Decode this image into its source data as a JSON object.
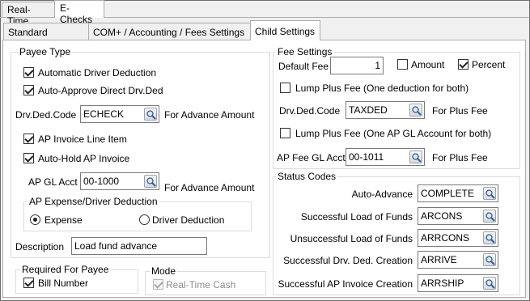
{
  "tabs_top": [
    "Real-Time",
    "E-Checks"
  ],
  "tabs_sub": [
    "Standard Settings",
    "COM+ / Accounting / Fees Settings",
    "Child Settings"
  ],
  "payee_type": {
    "legend": "Payee Type",
    "auto_driver_deduction": "Automatic Driver Deduction",
    "auto_approve": "Auto-Approve Direct Drv.Ded",
    "drv_ded_code_label": "Drv.Ded.Code",
    "drv_ded_code_value": "ECHECK",
    "for_advance_amount": "For Advance Amount",
    "ap_invoice_line_item": "AP Invoice Line Item",
    "auto_hold_ap_invoice": "Auto-Hold AP Invoice",
    "ap_gl_acct_label": "AP GL Acct",
    "ap_gl_acct_value": "00-1000",
    "for_advance_amount_2": "For Advance Amount",
    "ap_expense_legend": "AP Expense/Driver Deduction",
    "expense_label": "Expense",
    "driver_deduction_label": "Driver Deduction",
    "description_label": "Description",
    "description_value": "Load fund advance"
  },
  "required_for_payee": {
    "legend": "Required For Payee",
    "bill_number": "Bill Number"
  },
  "mode": {
    "legend": "Mode",
    "real_time_cash": "Real-Time Cash"
  },
  "fee_settings": {
    "legend": "Fee Settings",
    "default_fee_label": "Default Fee",
    "default_fee_value": "1",
    "amount_label": "Amount",
    "percent_label": "Percent",
    "lump_plus_fee_1": "Lump Plus Fee (One deduction for both)",
    "drv_ded_code_label": "Drv.Ded.Code",
    "drv_ded_code_value": "TAXDED",
    "for_plus_fee": "For Plus Fee",
    "lump_plus_fee_2": "Lump Plus Fee (One AP GL Account for both)",
    "ap_fee_gl_acct_label": "AP Fee GL Acct",
    "ap_fee_gl_acct_value": "00-1011",
    "for_plus_fee_2": "For Plus Fee"
  },
  "status_codes": {
    "legend": "Status Codes",
    "rows": [
      {
        "label": "Auto-Advance",
        "value": "COMPLETE"
      },
      {
        "label": "Successful Load of Funds",
        "value": "ARCONS"
      },
      {
        "label": "Unsuccessful Load of Funds",
        "value": "ARRCONS"
      },
      {
        "label": "Successful Drv. Ded. Creation",
        "value": "ARRIVE"
      },
      {
        "label": "Successful AP Invoice Creation",
        "value": "ARRSHIP"
      }
    ]
  }
}
